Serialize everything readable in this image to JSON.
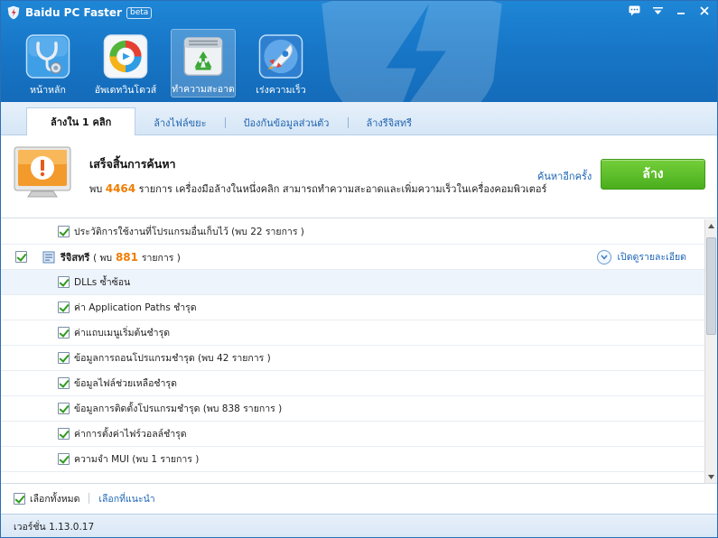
{
  "app": {
    "title": "Baidu PC Faster",
    "badge": "beta"
  },
  "window_controls": [
    "chat-icon",
    "menu-icon",
    "minimize-icon",
    "close-icon"
  ],
  "nav": [
    {
      "label": "หน้าหลัก",
      "icon": "stethoscope-icon"
    },
    {
      "label": "อัพเดทวินโดวส์",
      "icon": "update-icon"
    },
    {
      "label": "ทำความสะอาด",
      "icon": "recycle-icon",
      "active": true
    },
    {
      "label": "เร่งความเร็ว",
      "icon": "rocket-icon"
    }
  ],
  "tabs": [
    {
      "label": "ล้างใน 1 คลิก",
      "active": true
    },
    {
      "label": "ล้างไฟล์ขยะ"
    },
    {
      "label": "ป้องกันข้อมูลส่วนตัว"
    },
    {
      "label": "ล้างรีจิสทรี"
    }
  ],
  "status": {
    "title": "เสร็จสิ้นการค้นหา",
    "desc_prefix": "พบ",
    "count": "4464",
    "desc_suffix": "รายการ เครื่องมือล้างในหนึ่งคลิก สามารถทำความสะอาดและเพิ่มความเร็วในเครื่องคอมพิวเตอร์",
    "rescan": "ค้นหาอีกครั้ง",
    "clean_button": "ล้าง",
    "accent": "#f07d00"
  },
  "list": {
    "top_item": "ประวัติการใช้งานที่โปรแกรมอื่นเก็บไว้ (พบ 22 รายการ )",
    "group": {
      "name": "รีจิสทรี",
      "prefix": "( พบ",
      "count": "881",
      "suffix": "รายการ )",
      "details": "เปิดดูรายละเอียด"
    },
    "items": [
      "DLLs ซ้ำซ้อน",
      "ค่า Application Paths ชำรุด",
      "ค่าแถบเมนูเริ่มต้นชำรุด",
      "ข้อมูลการถอนโปรแกรมชำรุด (พบ 42 รายการ )",
      "ข้อมูลไฟล์ช่วยเหลือชำรุด",
      "ข้อมูลการติดตั้งโปรแกรมชำรุด (พบ 838 รายการ )",
      "ค่าการตั้งค่าไฟร์วอลล์ชำรุด",
      "ความจำ MUI (พบ 1 รายการ )"
    ]
  },
  "footer": {
    "select_all": "เลือกทั้งหมด",
    "select_recommended": "เลือกที่แนะนำ"
  },
  "version": "เวอร์ชั่น  1.13.0.17",
  "colors": {
    "header": "#1877c8",
    "clean_button": "#4aae1d",
    "link": "#1b63b6"
  }
}
